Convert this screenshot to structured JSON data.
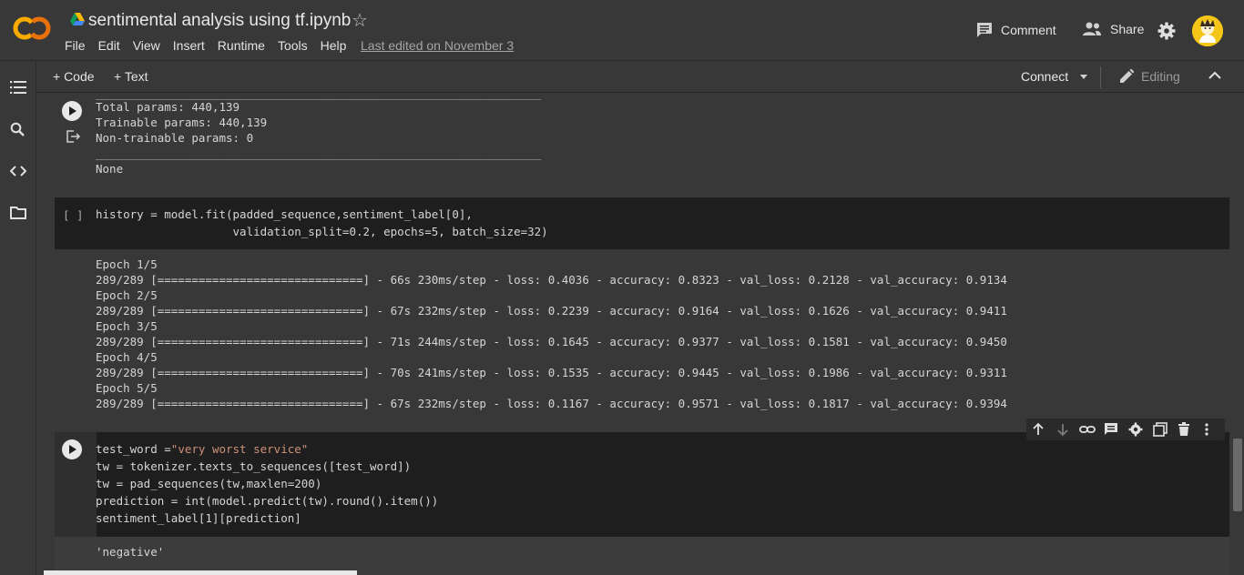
{
  "app": {
    "logo_text": "CO",
    "title": "sentimental analysis using tf.ipynb",
    "last_edited": "Last edited on November 3"
  },
  "menu": [
    "File",
    "Edit",
    "View",
    "Insert",
    "Runtime",
    "Tools",
    "Help"
  ],
  "header_actions": {
    "comment_label": "Comment",
    "share_label": "Share"
  },
  "toolbar": {
    "add_code": "+ Code",
    "add_text": "+ Text",
    "connect_label": "Connect",
    "editing_label": "Editing"
  },
  "sidebar": {
    "items": [
      "table-of-contents-icon",
      "search-icon",
      "code-snippets-icon",
      "files-icon"
    ]
  },
  "cells": {
    "summary_output": {
      "separator_top": "_________________________________________________________________",
      "lines": [
        "Total params: 440,139",
        "Trainable params: 440,139",
        "Non-trainable params: 0"
      ],
      "separator_bottom": "_________________________________________________________________",
      "none_text": "None"
    },
    "fit_cell": {
      "prompt": "[ ]",
      "code_line1": "history = model.fit(padded_sequence,sentiment_label[0],",
      "code_line2": "                    validation_split=0.2, epochs=5, batch_size=32)",
      "output": [
        "Epoch 1/5",
        "289/289 [==============================] - 66s 230ms/step - loss: 0.4036 - accuracy: 0.8323 - val_loss: 0.2128 - val_accuracy: 0.9134",
        "Epoch 2/5",
        "289/289 [==============================] - 67s 232ms/step - loss: 0.2239 - accuracy: 0.9164 - val_loss: 0.1626 - val_accuracy: 0.9411",
        "Epoch 3/5",
        "289/289 [==============================] - 71s 244ms/step - loss: 0.1645 - accuracy: 0.9377 - val_loss: 0.1581 - val_accuracy: 0.9450",
        "Epoch 4/5",
        "289/289 [==============================] - 70s 241ms/step - loss: 0.1535 - accuracy: 0.9445 - val_loss: 0.1986 - val_accuracy: 0.9311",
        "Epoch 5/5",
        "289/289 [==============================] - 67s 232ms/step - loss: 0.1167 - accuracy: 0.9571 - val_loss: 0.1817 - val_accuracy: 0.9394"
      ]
    },
    "predict_cell": {
      "line1_prefix": "test_word =",
      "line1_string": "\"very worst service\"",
      "line2": "tw = tokenizer.texts_to_sequences([test_word])",
      "line3_prefix": "tw = pad_sequences(tw,maxlen=",
      "line3_num": "200",
      "line3_suffix": ")",
      "line4": "prediction = int(model.predict(tw).round().item())",
      "line5": "sentiment_label[1][prediction]",
      "output": "'negative'"
    }
  },
  "colors": {
    "background": "#383838",
    "cell_background": "#1e1e1e",
    "string": "#ce9178",
    "logo_orange": "#f9ab00"
  }
}
